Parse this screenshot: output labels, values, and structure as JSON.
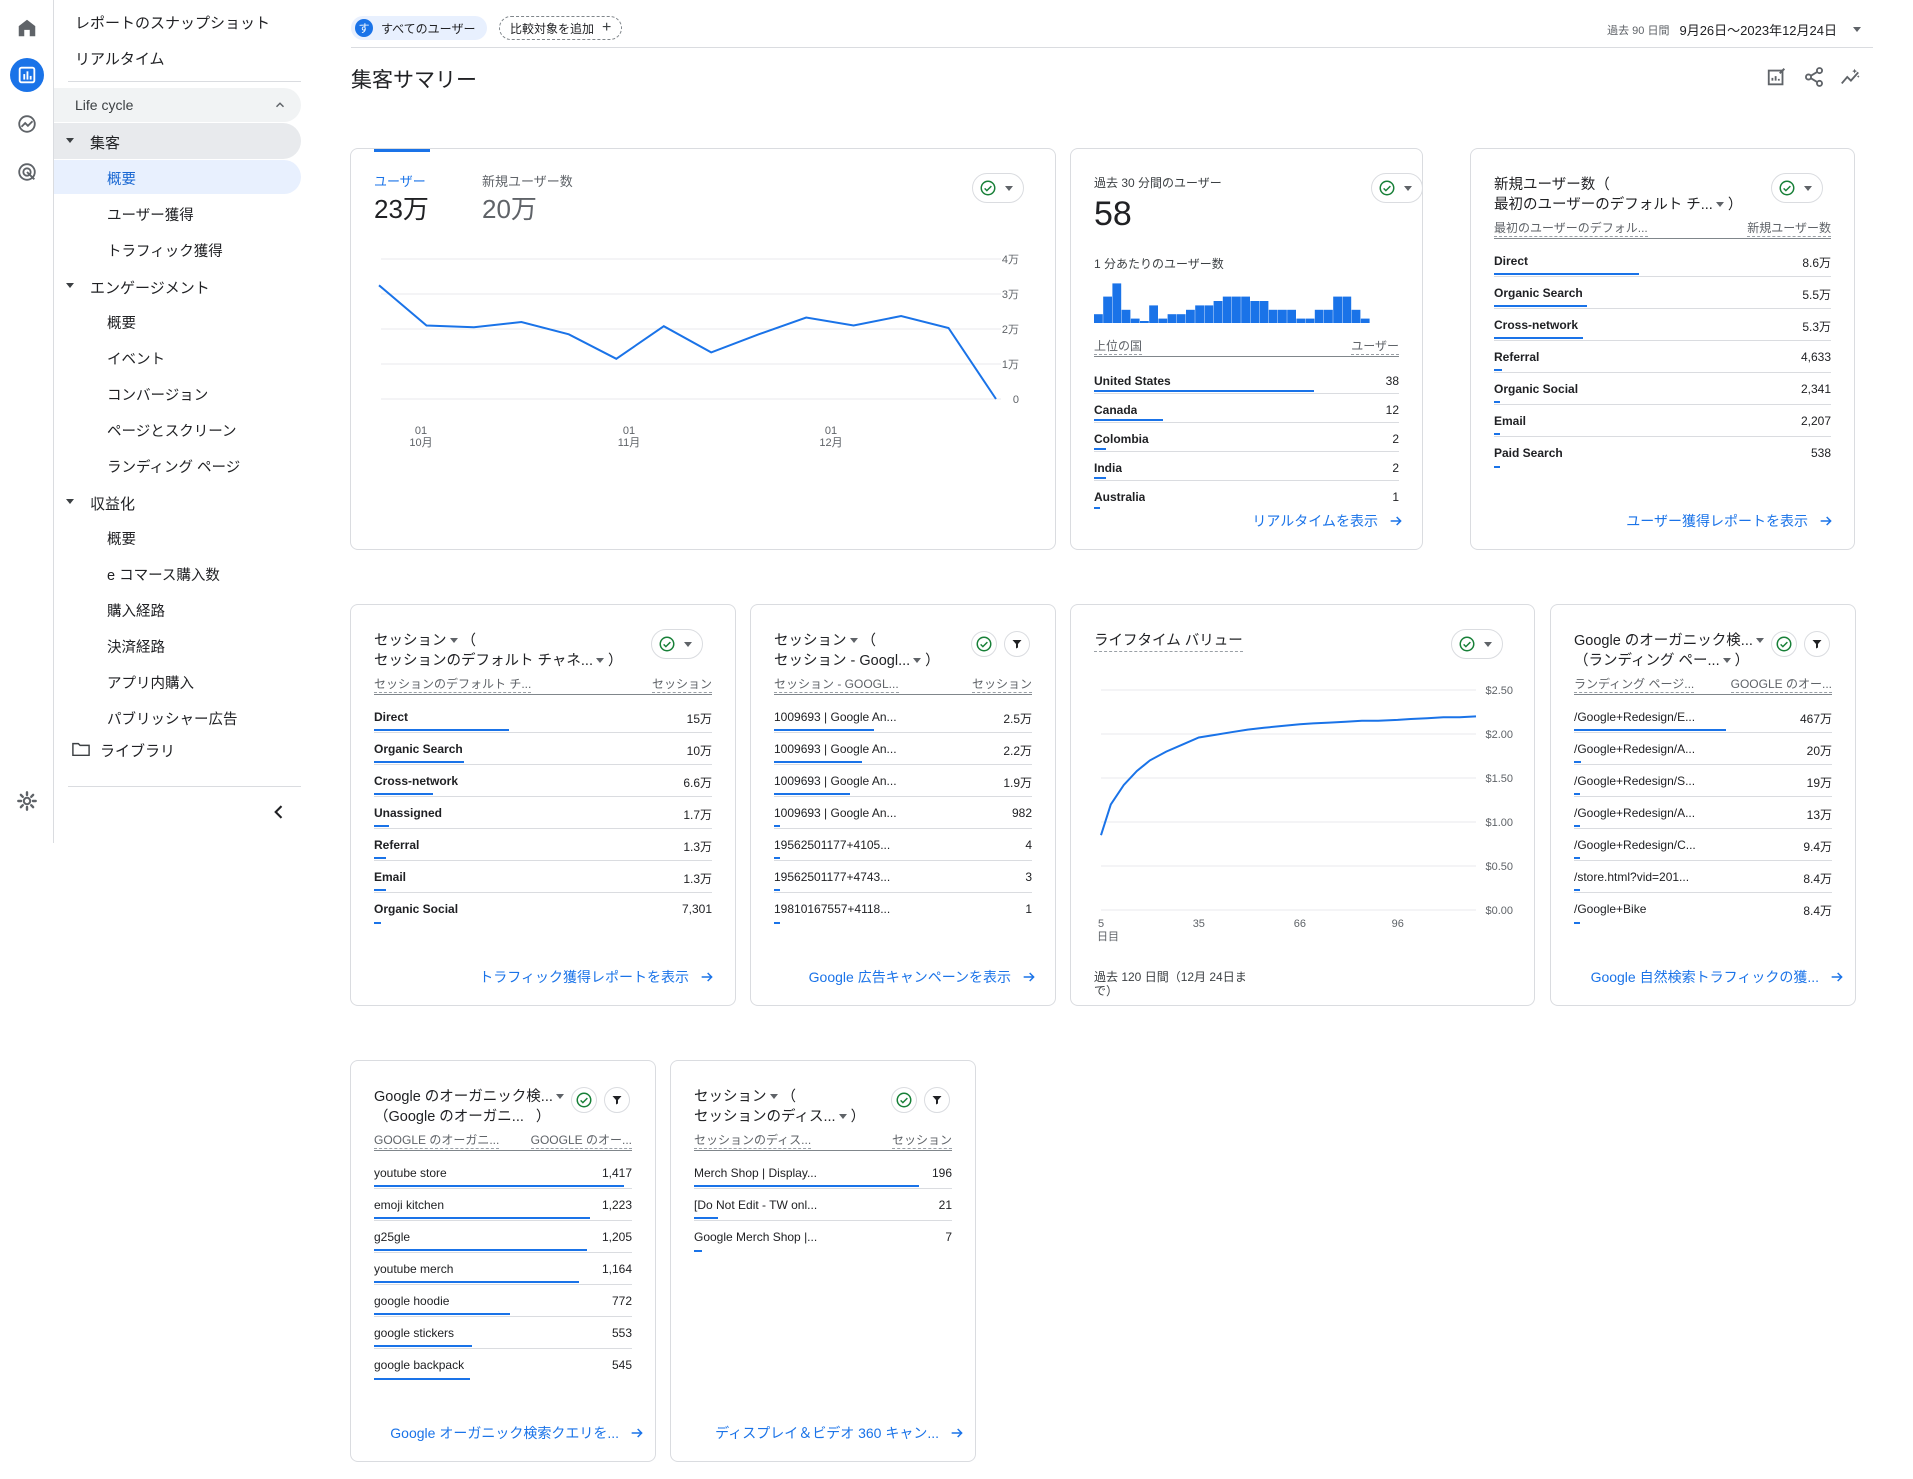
{
  "nav": {
    "top_items": [
      "レポートのスナップショット",
      "リアルタイム"
    ],
    "lifecycle_label": "Life cycle",
    "sections": [
      {
        "label": "集客",
        "items": [
          "概要",
          "ユーザー獲得",
          "トラフィック獲得"
        ]
      },
      {
        "label": "エンゲージメント",
        "items": [
          "概要",
          "イベント",
          "コンバージョン",
          "ページとスクリーン",
          "ランディング ページ"
        ]
      },
      {
        "label": "収益化",
        "items": [
          "概要",
          "e コマース購入数",
          "購入経路",
          "決済経路",
          "アプリ内購入",
          "パブリッシャー広告"
        ]
      }
    ],
    "library_label": "ライブラリ"
  },
  "header": {
    "users_chip_avatar": "す",
    "users_chip_label": "すべてのユーザー",
    "compare_label": "比較対象を追加",
    "compare_plus": "+",
    "date_range_label": "過去 90 日間",
    "date_range_value": "9月26日～2023年12月24日"
  },
  "page_title": "集客サマリー",
  "card_users": {
    "tab1_label": "ユーザー",
    "tab1_value": "23万",
    "tab2_label": "新規ユーザー数",
    "tab2_value": "20万",
    "y_ticks": [
      "4万",
      "3万",
      "2万",
      "1万",
      "0"
    ],
    "x_ticks": [
      {
        "day": "01",
        "month": "10月"
      },
      {
        "day": "01",
        "month": "11月"
      },
      {
        "day": "01",
        "month": "12月"
      }
    ]
  },
  "card_realtime": {
    "title": "過去 30 分間のユーザー",
    "value": "58",
    "subtitle": "1 分あたりのユーザー数",
    "col_left": "上位の国",
    "col_right": "ユーザー",
    "rows": [
      {
        "label": "United States",
        "value": "38"
      },
      {
        "label": "Canada",
        "value": "12"
      },
      {
        "label": "Colombia",
        "value": "2"
      },
      {
        "label": "India",
        "value": "2"
      },
      {
        "label": "Australia",
        "value": "1"
      }
    ],
    "link": "リアルタイムを表示"
  },
  "card_new_users": {
    "title_line1": "新規ユーザー数（",
    "title_line2": "最初のユーザーのデフォルト チ...",
    "title_close": "）",
    "col_left": "最初のユーザーのデフォル...",
    "col_right": "新規ユーザー数",
    "rows": [
      {
        "label": "Direct",
        "value": "8.6万"
      },
      {
        "label": "Organic Search",
        "value": "5.5万"
      },
      {
        "label": "Cross-network",
        "value": "5.3万"
      },
      {
        "label": "Referral",
        "value": "4,633"
      },
      {
        "label": "Organic Social",
        "value": "2,341"
      },
      {
        "label": "Email",
        "value": "2,207"
      },
      {
        "label": "Paid Search",
        "value": "538"
      }
    ],
    "link": "ユーザー獲得レポートを表示"
  },
  "card_sessions_channel": {
    "title_line1": "セッション",
    "title_line1b": "（",
    "title_line2": "セッションのデフォルト チャネ...",
    "title_close": "）",
    "col_left": "セッションのデフォルト チ...",
    "col_right": "セッション",
    "rows": [
      {
        "label": "Direct",
        "value": "15万"
      },
      {
        "label": "Organic Search",
        "value": "10万"
      },
      {
        "label": "Cross-network",
        "value": "6.6万"
      },
      {
        "label": "Unassigned",
        "value": "1.7万"
      },
      {
        "label": "Referral",
        "value": "1.3万"
      },
      {
        "label": "Email",
        "value": "1.3万"
      },
      {
        "label": "Organic Social",
        "value": "7,301"
      }
    ],
    "link": "トラフィック獲得レポートを表示"
  },
  "card_sessions_google": {
    "title_line1": "セッション",
    "title_line1b": "（",
    "title_line2": "セッション - Googl...",
    "title_close": "）",
    "col_left": "セッション - GOOGL...",
    "col_right": "セッション",
    "rows": [
      {
        "label": "1009693 | Google An...",
        "value": "2.5万"
      },
      {
        "label": "1009693 | Google An...",
        "value": "2.2万"
      },
      {
        "label": "1009693 | Google An...",
        "value": "1.9万"
      },
      {
        "label": "1009693 | Google An...",
        "value": "982"
      },
      {
        "label": "19562501177+4105...",
        "value": "4"
      },
      {
        "label": "19562501177+4743...",
        "value": "3"
      },
      {
        "label": "19810167557+4118...",
        "value": "1"
      }
    ],
    "link": "Google 広告キャンペーンを表示"
  },
  "card_ltv": {
    "title": "ライフタイム バリュー",
    "y_ticks": [
      "$2.50",
      "$2.00",
      "$1.50",
      "$1.00",
      "$0.50",
      "$0.00"
    ],
    "x_ticks": [
      "5",
      "35",
      "66",
      "96"
    ],
    "x_unit": "日目",
    "footer_line1": "過去 120 日間（12月 24日ま",
    "footer_line2": "で）"
  },
  "card_landing": {
    "title_line1": "Google のオーガニック検...",
    "title_line2": "（ランディング ペー...",
    "title_close": "）",
    "col_left": "ランディング ページ...",
    "col_right": "GOOGLE のオー...",
    "rows": [
      {
        "label": "/Google+Redesign/E...",
        "value": "467万"
      },
      {
        "label": "/Google+Redesign/A...",
        "value": "20万"
      },
      {
        "label": "/Google+Redesign/S...",
        "value": "19万"
      },
      {
        "label": "/Google+Redesign/A...",
        "value": "13万"
      },
      {
        "label": "/Google+Redesign/C...",
        "value": "9.4万"
      },
      {
        "label": "/store.html?vid=201...",
        "value": "8.4万"
      },
      {
        "label": "/Google+Bike",
        "value": "8.4万"
      }
    ],
    "link": "Google 自然検索トラフィックの獲..."
  },
  "card_queries": {
    "title_line1": "Google のオーガニック検...",
    "title_line2": "（Google のオーガニ...",
    "title_close": "）",
    "col_left": "GOOGLE のオーガニ...",
    "col_right": "GOOGLE のオー...",
    "rows": [
      {
        "label": "youtube store",
        "value": "1,417"
      },
      {
        "label": "emoji kitchen",
        "value": "1,223"
      },
      {
        "label": "g25gle",
        "value": "1,205"
      },
      {
        "label": "youtube merch",
        "value": "1,164"
      },
      {
        "label": "google hoodie",
        "value": "772"
      },
      {
        "label": "google stickers",
        "value": "553"
      },
      {
        "label": "google backpack",
        "value": "545"
      }
    ],
    "link": "Google オーガニック検索クエリを..."
  },
  "card_display": {
    "title_line1": "セッション",
    "title_line1b": "（",
    "title_line2": "セッションのディス...",
    "title_close": "）",
    "col_left": "セッションのディス...",
    "col_right": "セッション",
    "rows": [
      {
        "label": "Merch Shop | Display...",
        "value": "196"
      },
      {
        "label": "[Do Not Edit - TW onl...",
        "value": "21"
      },
      {
        "label": "Google Merch Shop |...",
        "value": "7"
      }
    ],
    "link": "ディスプレイ＆ビデオ 360 キャン..."
  },
  "chart_data": [
    {
      "type": "line",
      "name_hint": "users",
      "x": [
        "09-26",
        "10-03",
        "10-10",
        "10-17",
        "10-24",
        "10-31",
        "11-07",
        "11-14",
        "11-21",
        "11-28",
        "12-05",
        "12-12",
        "12-19",
        "12-24"
      ],
      "series": [
        {
          "values": [
            32500,
            21000,
            20500,
            22000,
            18500,
            11500,
            20800,
            13300,
            18500,
            23300,
            21000,
            23700,
            20300,
            0
          ]
        }
      ],
      "ylim": [
        0,
        40000
      ],
      "y_ticks": [
        "4万",
        "3万",
        "2万",
        "1万",
        "0"
      ],
      "x_tick_labels": [
        "01 10月",
        "01 11月",
        "01 12月"
      ]
    },
    {
      "type": "bar",
      "name_hint": "users_per_minute",
      "values": [
        2,
        6,
        9,
        3,
        1,
        0,
        4,
        1,
        2,
        2,
        3,
        4,
        4,
        5,
        6,
        6,
        6,
        5,
        5,
        3,
        3,
        3,
        1,
        1,
        3,
        3,
        6,
        6,
        3,
        1
      ],
      "ylim": [
        0,
        10
      ]
    },
    {
      "type": "line",
      "name_hint": "lifetime_value",
      "x": [
        5,
        8,
        12,
        16,
        20,
        25,
        30,
        35,
        40,
        45,
        50,
        55,
        60,
        66,
        70,
        75,
        80,
        85,
        90,
        96,
        100,
        105,
        110,
        115,
        120
      ],
      "series": [
        {
          "values": [
            0.85,
            1.2,
            1.42,
            1.58,
            1.7,
            1.8,
            1.88,
            1.96,
            1.99,
            2.02,
            2.05,
            2.07,
            2.09,
            2.11,
            2.12,
            2.13,
            2.14,
            2.15,
            2.15,
            2.16,
            2.17,
            2.18,
            2.19,
            2.19,
            2.2
          ]
        }
      ],
      "ylim": [
        0,
        2.5
      ],
      "y_ticks": [
        "$2.50",
        "$2.00",
        "$1.50",
        "$1.00",
        "$0.50",
        "$0.00"
      ],
      "x_tick_labels": [
        "5",
        "35",
        "66",
        "96"
      ]
    }
  ]
}
